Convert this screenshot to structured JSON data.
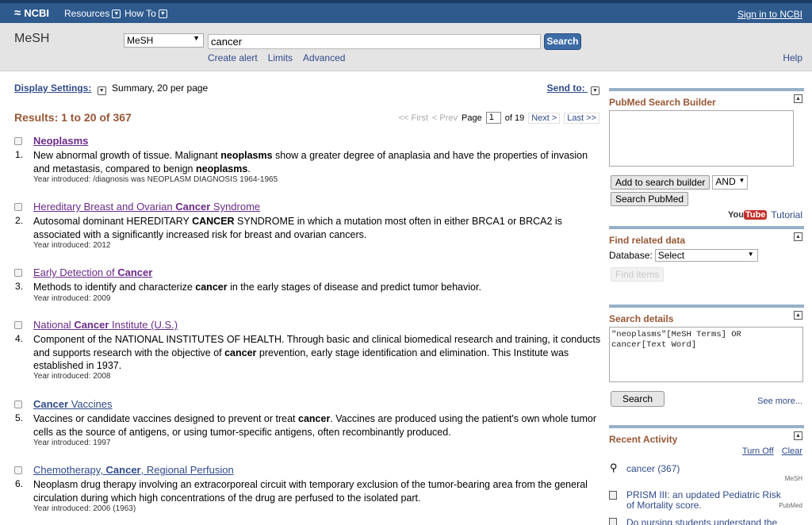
{
  "topbar": {
    "logo": "NCBI",
    "resources": "Resources",
    "howto": "How To",
    "signin": "Sign in to NCBI"
  },
  "search": {
    "db_title": "MeSH",
    "db_selected": "MeSH",
    "query": "cancer",
    "button": "Search",
    "links": [
      "Create alert",
      "Limits",
      "Advanced"
    ],
    "help": "Help"
  },
  "display": {
    "label": "Display Settings:",
    "summary": "Summary, 20 per page",
    "sendto": "Send to:"
  },
  "results_header": "Results: 1 to 20 of 367",
  "pager": {
    "first": "<< First",
    "prev": "< Prev",
    "page_label": "Page",
    "page": "1",
    "of": "of 19",
    "next": "Next >",
    "last": "Last >>"
  },
  "results": [
    {
      "num": "1.",
      "title": [
        "",
        "Neoplasms",
        ""
      ],
      "desc": [
        "New abnormal growth of tissue. Malignant ",
        "neoplasms",
        " show a greater degree of anaplasia and have the properties of invasion and metastasis, compared to benign ",
        "neoplasms",
        "."
      ],
      "intro": "Year introduced: /diagnosis was NEOPLASM DIAGNOSIS 1964-1965"
    },
    {
      "num": "2.",
      "title": [
        "Hereditary Breast and Ovarian ",
        "Cancer",
        " Syndrome"
      ],
      "desc": [
        "Autosomal dominant HEREDITARY ",
        "CANCER",
        " SYNDROME in which a mutation most often in either BRCA1 or BRCA2 is associated with a significantly increased risk for breast and ovarian cancers.",
        "",
        ""
      ],
      "intro": "Year introduced: 2012"
    },
    {
      "num": "3.",
      "title": [
        "Early Detection of ",
        "Cancer",
        ""
      ],
      "desc": [
        "Methods to identify and characterize ",
        "cancer",
        " in the early stages of disease and predict tumor behavior.",
        "",
        ""
      ],
      "intro": "Year introduced: 2009"
    },
    {
      "num": "4.",
      "title": [
        "National ",
        "Cancer",
        " Institute (U.S.)"
      ],
      "desc": [
        "Component of the NATIONAL INSTITUTES OF HEALTH. Through basic and clinical biomedical research and training, it conducts and supports research with the objective of ",
        "cancer",
        " prevention, early stage identification and elimination. This Institute was established in 1937.",
        "",
        ""
      ],
      "intro": "Year introduced: 2008"
    },
    {
      "num": "5.",
      "title": [
        "",
        "Cancer",
        " Vaccines"
      ],
      "desc": [
        "Vaccines or candidate vaccines designed to prevent or treat ",
        "cancer",
        ". Vaccines are produced using the patient's own whole tumor cells as the source of antigens, or using tumor-specific antigens, often recombinantly produced.",
        "",
        ""
      ],
      "intro": "Year introduced: 1997"
    },
    {
      "num": "6.",
      "title": [
        "Chemotherapy, ",
        "Cancer",
        ", Regional Perfusion"
      ],
      "desc": [
        "Neoplasm drug therapy involving an extracorporeal circuit with temporary exclusion of the tumor-bearing area from the general circulation during which high concentrations of the drug are perfused to the isolated part.",
        "",
        "",
        "",
        ""
      ],
      "intro": "Year introduced: 2006 (1963)"
    }
  ],
  "sidebar": {
    "builder": {
      "title": "PubMed Search Builder",
      "add_btn": "Add to search builder",
      "op": "AND",
      "search_btn": "Search PubMed",
      "yt_you": "You",
      "yt_tube": "Tube",
      "tutorial": "Tutorial"
    },
    "related": {
      "title": "Find related data",
      "db_label": "Database:",
      "db_value": "Select",
      "find_btn": "Find items"
    },
    "details": {
      "title": "Search details",
      "query": "\"neoplasms\"[MeSH Terms] OR cancer[Text Word]",
      "search_btn": "Search",
      "see_more": "See more..."
    },
    "recent": {
      "title": "Recent Activity",
      "turn_off": "Turn Off",
      "clear": "Clear",
      "items": [
        {
          "text": "cancer (367)",
          "db": "MeSH"
        },
        {
          "text": "PRISM III: an updated Pediatric Risk of Mortality score.",
          "db": "PubMed"
        },
        {
          "text": "Do nursing students understand the",
          "db": ""
        }
      ]
    }
  }
}
